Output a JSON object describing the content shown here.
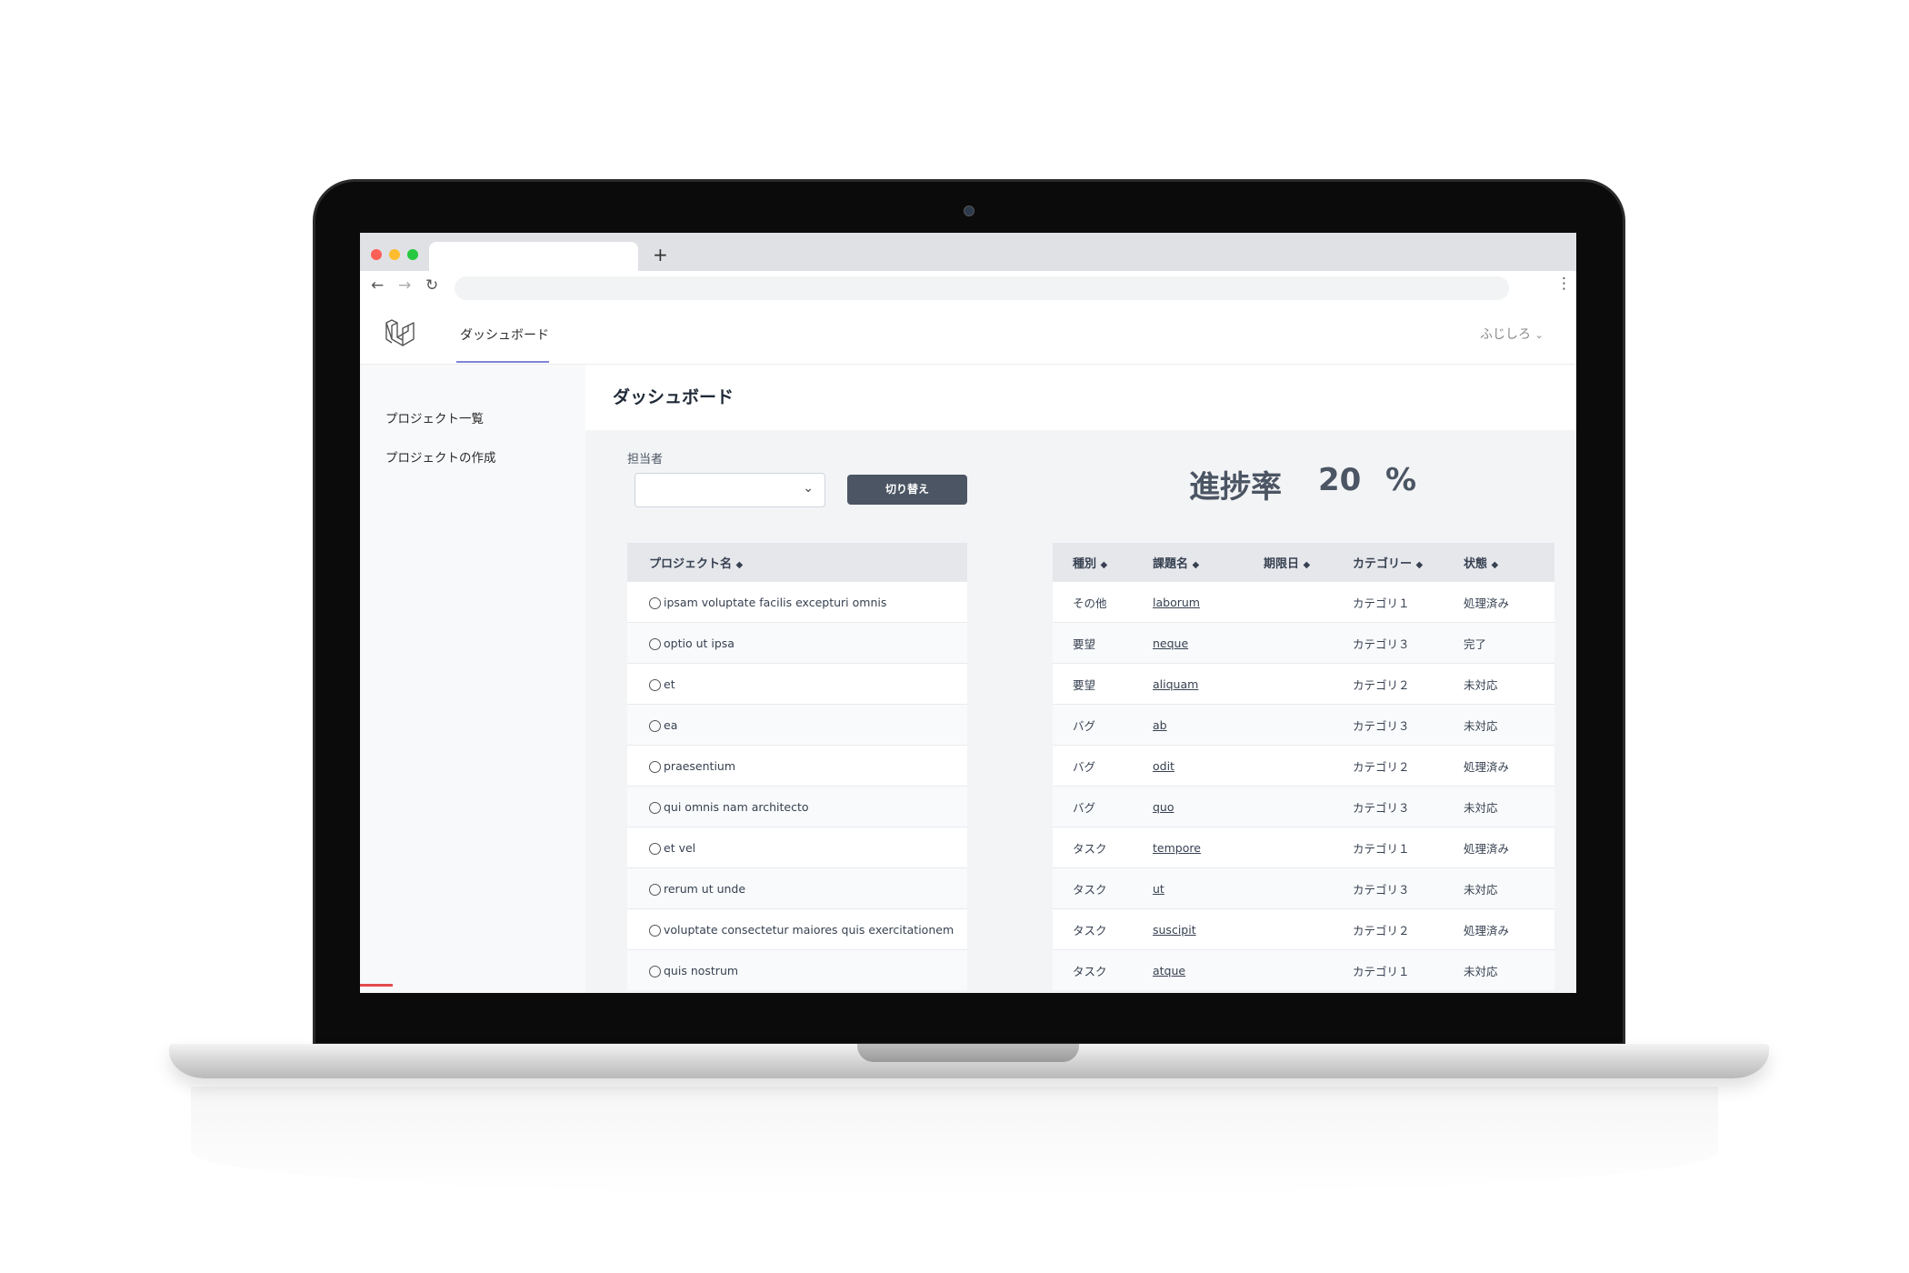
{
  "browser": {
    "new_tab_label": "+",
    "back_icon": "arrow-left-icon",
    "forward_icon": "arrow-right-icon",
    "reload_icon": "reload-icon",
    "menu_icon": "kebab-menu-icon"
  },
  "header": {
    "nav_dashboard": "ダッシュボード",
    "user_name": "ふじしろ"
  },
  "sidebar": {
    "items": [
      "プロジェクト一覧",
      "プロジェクトの作成"
    ]
  },
  "page": {
    "title": "ダッシュボード"
  },
  "filter": {
    "assignee_label": "担当者",
    "assignee_value": "",
    "switch_button": "切り替え"
  },
  "progress": {
    "label": "進捗率",
    "value": "20",
    "unit": "%"
  },
  "projects": {
    "header": "プロジェクト名",
    "rows": [
      "ipsam voluptate facilis excepturi omnis",
      "optio ut ipsa",
      "et",
      "ea",
      "praesentium",
      "qui omnis nam architecto",
      "et vel",
      "rerum ut unde",
      "voluptate consectetur maiores quis exercitationem",
      "quis nostrum"
    ]
  },
  "issues": {
    "headers": [
      "種別",
      "課題名",
      "期限日",
      "カテゴリー",
      "状態"
    ],
    "rows": [
      {
        "type": "その他",
        "name": "laborum",
        "due": "",
        "category": "カテゴリ１",
        "status": "処理済み"
      },
      {
        "type": "要望",
        "name": "neque",
        "due": "",
        "category": "カテゴリ３",
        "status": "完了"
      },
      {
        "type": "要望",
        "name": "aliquam",
        "due": "",
        "category": "カテゴリ２",
        "status": "未対応"
      },
      {
        "type": "バグ",
        "name": "ab",
        "due": "",
        "category": "カテゴリ３",
        "status": "未対応"
      },
      {
        "type": "バグ",
        "name": "odit",
        "due": "",
        "category": "カテゴリ２",
        "status": "処理済み"
      },
      {
        "type": "バグ",
        "name": "quo",
        "due": "",
        "category": "カテゴリ３",
        "status": "未対応"
      },
      {
        "type": "タスク",
        "name": "tempore",
        "due": "",
        "category": "カテゴリ１",
        "status": "処理済み"
      },
      {
        "type": "タスク",
        "name": "ut",
        "due": "",
        "category": "カテゴリ３",
        "status": "未対応"
      },
      {
        "type": "タスク",
        "name": "suscipit",
        "due": "",
        "category": "カテゴリ２",
        "status": "処理済み"
      },
      {
        "type": "タスク",
        "name": "atque",
        "due": "",
        "category": "カテゴリ１",
        "status": "未対応"
      }
    ]
  },
  "colors": {
    "accent": "#7e85d6",
    "button": "#4b5563",
    "content_bg": "#f3f4f6"
  }
}
